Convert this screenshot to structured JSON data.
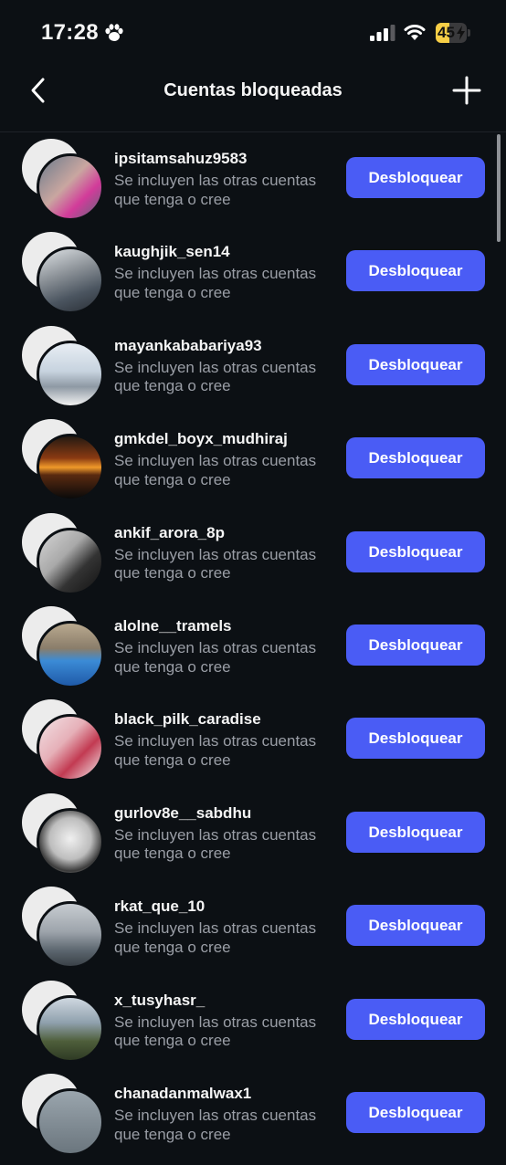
{
  "status_bar": {
    "time": "17:28",
    "battery_level": "45",
    "battery_color": "#f7ce46"
  },
  "header": {
    "title": "Cuentas bloqueadas",
    "back_icon": "chevron-left-icon",
    "add_icon": "plus-icon"
  },
  "accent_color": "#4a5cf5",
  "accounts": [
    {
      "username": "ipsitamsahuz9583",
      "description": "Se incluyen las otras cuentas que tenga o cree",
      "button": "Desbloquear"
    },
    {
      "username": "kaughjik_sen14",
      "description": "Se incluyen las otras cuentas que tenga o cree",
      "button": "Desbloquear"
    },
    {
      "username": "mayankababariya93",
      "description": "Se incluyen las otras cuentas que tenga o cree",
      "button": "Desbloquear"
    },
    {
      "username": "gmkdel_boyx_mudhiraj",
      "description": "Se incluyen las otras cuentas que tenga o cree",
      "button": "Desbloquear"
    },
    {
      "username": "ankif_arora_8p",
      "description": "Se incluyen las otras cuentas que tenga o cree",
      "button": "Desbloquear"
    },
    {
      "username": "alolne__tramels",
      "description": "Se incluyen las otras cuentas que tenga o cree",
      "button": "Desbloquear"
    },
    {
      "username": "black_pilk_caradise",
      "description": "Se incluyen las otras cuentas que tenga o cree",
      "button": "Desbloquear"
    },
    {
      "username": "gurlov8e__sabdhu",
      "description": "Se incluyen las otras cuentas que tenga o cree",
      "button": "Desbloquear"
    },
    {
      "username": "rkat_que_10",
      "description": "Se incluyen las otras cuentas que tenga o cree",
      "button": "Desbloquear"
    },
    {
      "username": "x_tusyhasr_",
      "description": "Se incluyen las otras cuentas que tenga o cree",
      "button": "Desbloquear"
    },
    {
      "username": "chanadanmalwax1",
      "description": "Se incluyen las otras cuentas que tenga o cree",
      "button": "Desbloquear"
    }
  ]
}
